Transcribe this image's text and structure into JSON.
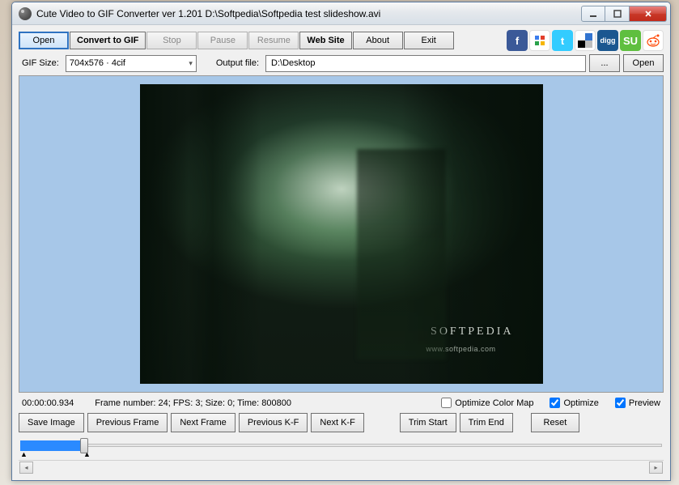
{
  "titlebar": {
    "title": "Cute Video to GIF Converter ver 1.201  D:\\Softpedia\\Softpedia test slideshow.avi"
  },
  "toolbar": {
    "open": "Open",
    "convert": "Convert to GIF",
    "stop": "Stop",
    "pause": "Pause",
    "resume": "Resume",
    "website": "Web Site",
    "about": "About",
    "exit": "Exit"
  },
  "socials": {
    "fb": "f",
    "tw": "t",
    "digg": "digg",
    "su": "SU"
  },
  "settings": {
    "gif_size_label": "GIF Size:",
    "gif_size_value": "704x576 · 4cif",
    "output_label": "Output file:",
    "output_value": "D:\\Desktop",
    "browse": "...",
    "open": "Open"
  },
  "watermark": {
    "main": "SOFTPEDIA",
    "sub": "www.softpedia.com"
  },
  "status": {
    "time": "00:00:00.934",
    "frame": "Frame number: 24; FPS: 3; Size: 0; Time: 800800",
    "opt_color": "Optimize Color Map",
    "optimize": "Optimize",
    "preview": "Preview"
  },
  "actions": {
    "save_image": "Save Image",
    "prev_frame": "Previous Frame",
    "next_frame": "Next Frame",
    "prev_kf": "Previous K-F",
    "next_kf": "Next K-F",
    "trim_start": "Trim Start",
    "trim_end": "Trim End",
    "reset": "Reset"
  },
  "slider": {
    "mark_left": "▲",
    "mark_right": "▲"
  }
}
